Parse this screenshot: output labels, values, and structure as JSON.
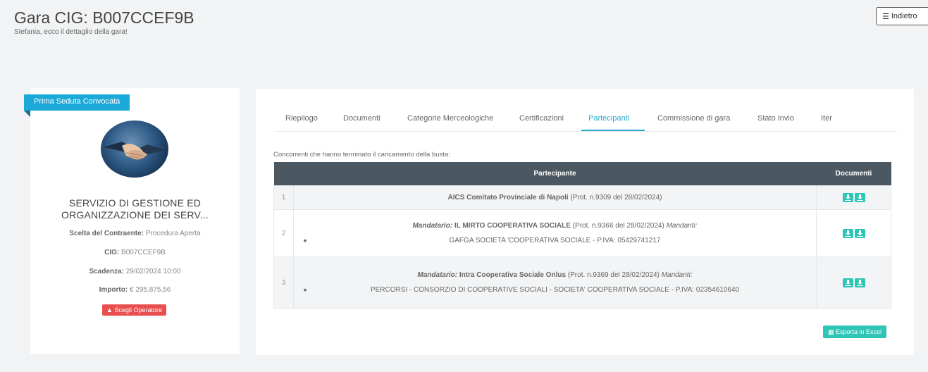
{
  "header": {
    "title": "Gara CIG: B007CCEF9B",
    "subtitle": "Stefania, ecco il dettaglio della gara!",
    "back_label": "Indietro"
  },
  "tender_card": {
    "status_badge": "Prima Seduta Convocata",
    "title_line1": "SERVIZIO DI GESTIONE ED",
    "title_line2": "ORGANIZZAZIONE DEI SERV...",
    "rows": [
      {
        "label": "Scelta del Contraente:",
        "value": "Procedura Aperta"
      },
      {
        "label": "CIG:",
        "value": "B007CCEF9B"
      },
      {
        "label": "Scadenza:",
        "value": "29/02/2024 10:00"
      },
      {
        "label": "Importo:",
        "value": "€ 295.875,56"
      }
    ],
    "operator_button": "Scegli Operatore"
  },
  "tabs": [
    {
      "label": "Riepilogo",
      "active": false
    },
    {
      "label": "Documenti",
      "active": false
    },
    {
      "label": "Categorie Merceologiche",
      "active": false
    },
    {
      "label": "Certificazioni",
      "active": false
    },
    {
      "label": "Partecipanti",
      "active": true
    },
    {
      "label": "Commissione di gara",
      "active": false
    },
    {
      "label": "Stato Invio",
      "active": false
    },
    {
      "label": "Iter",
      "active": false
    }
  ],
  "participants": {
    "caption": "Concorrenti che hanno terminato il caricamento della busta:",
    "columns": {
      "participant": "Partecipante",
      "documents": "Documenti"
    },
    "rows": [
      {
        "num": "1",
        "name": "AICS Comitato Provinciale di Napoli",
        "prot": "(Prot. n.9309 del 28/02/2024)"
      },
      {
        "num": "2",
        "mandatario_label": "Mandatario:",
        "name": "IL MIRTO COOPERATIVA SOCIALE",
        "prot": "(Prot. n.9366 del 28/02/2024)",
        "mandanti_label": "Mandanti:",
        "mandanti": "GAFGA SOCIETA 'COOPERATIVA SOCIALE - P.IVA: 05429741217"
      },
      {
        "num": "3",
        "mandatario_label": "Mandatario:",
        "name": "Intra Cooperativa Sociale Onlus",
        "prot": "(Prot. n.9369 del 28/02/2024)",
        "mandanti_label": "Mandanti:",
        "mandanti": "PERCORSI - CONSORZIO DI COOPERATIVE SOCIALI - SOCIETA' COOPERATIVA SOCIALE - P.IVA: 02354610640"
      }
    ],
    "export_label": "Esporta in Excel"
  },
  "colors": {
    "accent": "#27a9cf",
    "badge": "#1ba9d9",
    "danger": "#e94f4f",
    "download": "#2ec4b6",
    "table_header": "#4c5861"
  },
  "icons": [
    "list-icon",
    "warning-icon",
    "download-icon",
    "table-icon",
    "handshake-image"
  ]
}
